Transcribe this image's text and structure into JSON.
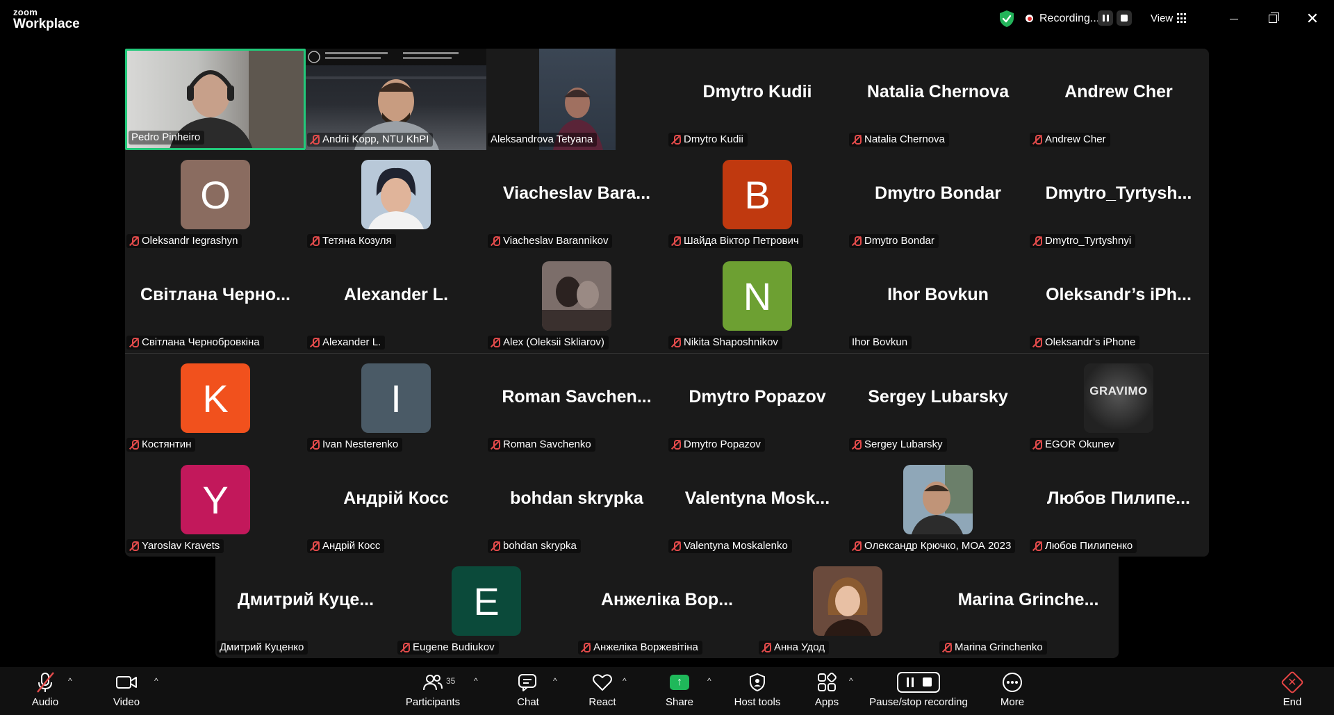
{
  "app": {
    "brand_small": "zoom",
    "brand_large": "Workplace"
  },
  "titlebar": {
    "recording_text": "Recording...",
    "view_label": "View"
  },
  "participants_row1": [
    {
      "name": "Pedro Pinheiro",
      "muted": false,
      "kind": "video"
    },
    {
      "name": "Andrii Kopp, NTU KhPI",
      "muted": true,
      "kind": "video"
    },
    {
      "name": "Aleksandrova Tetyana",
      "muted": false,
      "kind": "video"
    },
    {
      "name": "Dmytro Kudii",
      "display": "Dmytro Kudii",
      "muted": true,
      "kind": "name"
    },
    {
      "name": "Natalia Chernova",
      "display": "Natalia Chernova",
      "muted": true,
      "kind": "name"
    },
    {
      "name": "Andrew Cher",
      "display": "Andrew Cher",
      "muted": true,
      "kind": "name"
    }
  ],
  "participants_row2": [
    {
      "name": "Oleksandr Iegrashyn",
      "letter": "O",
      "color": "#8a6c60",
      "muted": true,
      "kind": "letter"
    },
    {
      "name": "Тетяна Козуля",
      "muted": true,
      "kind": "photo"
    },
    {
      "name": "Viacheslav Barannikov",
      "display": "Viacheslav  Bara...",
      "muted": true,
      "kind": "name"
    },
    {
      "name": "Шайда Віктор Петрович",
      "letter": "B",
      "color": "#c0390f",
      "muted": true,
      "kind": "letter"
    },
    {
      "name": "Dmytro Bondar",
      "display": "Dmytro Bondar",
      "muted": true,
      "kind": "name"
    },
    {
      "name": "Dmytro_Tyrtyshnyi",
      "display": "Dmytro_Tyrtysh...",
      "muted": true,
      "kind": "name"
    }
  ],
  "participants_row3": [
    {
      "name": "Світлана Чернобровкіна",
      "display": "Світлана  Черно...",
      "muted": true,
      "kind": "name"
    },
    {
      "name": "Alexander L.",
      "display": "Alexander L.",
      "muted": true,
      "kind": "name"
    },
    {
      "name": "Alex (Oleksii Skliarov)",
      "muted": true,
      "kind": "photo"
    },
    {
      "name": "Nikita Shaposhnikov",
      "letter": "N",
      "color": "#6da032",
      "muted": true,
      "kind": "letter"
    },
    {
      "name": "Ihor Bovkun",
      "display": "Ihor Bovkun",
      "muted": false,
      "kind": "name"
    },
    {
      "name": "Oleksandr’s iPhone",
      "display": "Oleksandr’s  iPh...",
      "muted": true,
      "kind": "name"
    }
  ],
  "participants_row4": [
    {
      "name": "Костянтин",
      "letter": "K",
      "color": "#f1511d",
      "muted": true,
      "kind": "letter"
    },
    {
      "name": "Ivan Nesterenko",
      "letter": "I",
      "color": "#4a5a66",
      "muted": true,
      "kind": "letter"
    },
    {
      "name": "Roman Savchenko",
      "display": "Roman  Savchen...",
      "muted": true,
      "kind": "name"
    },
    {
      "name": "Dmytro Popazov",
      "display": "Dmytro Popazov",
      "muted": true,
      "kind": "name"
    },
    {
      "name": "Sergey Lubarsky",
      "display": "Sergey Lubarsky",
      "muted": true,
      "kind": "name"
    },
    {
      "name": "EGOR Okunev",
      "muted": true,
      "kind": "logo",
      "logo_text": "GRAVIMO"
    }
  ],
  "participants_row5": [
    {
      "name": "Yaroslav Kravets",
      "letter": "Y",
      "color": "#c2185b",
      "muted": true,
      "kind": "letter"
    },
    {
      "name": "Андрій Косс",
      "display": "Андрій Косс",
      "muted": true,
      "kind": "name"
    },
    {
      "name": "bohdan skrypka",
      "display": "bohdan skrypka",
      "muted": true,
      "kind": "name"
    },
    {
      "name": "Valentyna Moskalenko",
      "display": "Valentyna  Mosk...",
      "muted": true,
      "kind": "name"
    },
    {
      "name": "Олександр Крючко, МОА 2023",
      "muted": true,
      "kind": "photo"
    },
    {
      "name": "Любов Пилипенко",
      "display": "Любов  Пилипе...",
      "muted": true,
      "kind": "name"
    }
  ],
  "participants_row6": [
    {
      "name": "Дмитрий Куценко",
      "display": "Дмитрий  Куце...",
      "muted": false,
      "kind": "name"
    },
    {
      "name": "Eugene Budiukov",
      "letter": "E",
      "color": "#0b4a3a",
      "muted": true,
      "kind": "letter"
    },
    {
      "name": "Анжеліка Воржевітіна",
      "display": "Анжеліка  Вор...",
      "muted": true,
      "kind": "name"
    },
    {
      "name": "Анна Удод",
      "muted": true,
      "kind": "photo"
    },
    {
      "name": "Marina Grinchenko",
      "display": "Marina  Grinche...",
      "muted": true,
      "kind": "name"
    }
  ],
  "toolbar": {
    "audio": "Audio",
    "video": "Video",
    "participants": "Participants",
    "participants_count": "35",
    "chat": "Chat",
    "react": "React",
    "share": "Share",
    "host_tools": "Host tools",
    "apps": "Apps",
    "pause_stop": "Pause/stop recording",
    "more": "More",
    "end": "End"
  },
  "colors": {
    "active_speaker": "#22c87a",
    "mute_red": "#e24b4b",
    "share_green": "#1fb85a",
    "end_red": "#e84545"
  }
}
